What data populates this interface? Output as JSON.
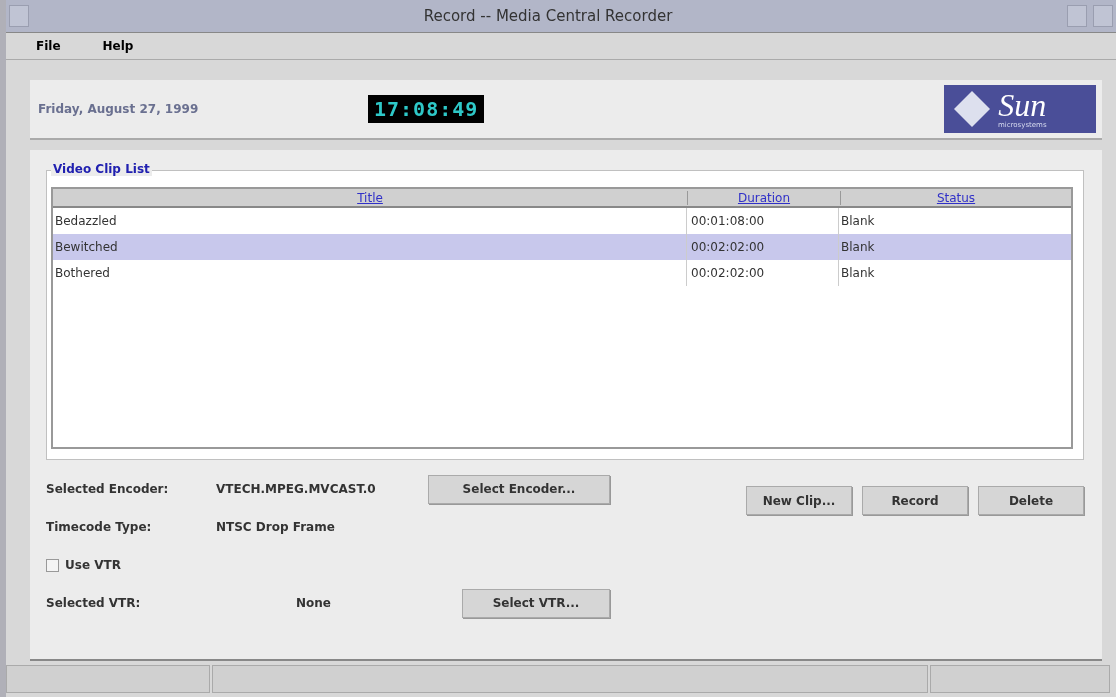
{
  "window": {
    "title": "Record -- Media Central Recorder"
  },
  "menu": [
    "File",
    "Help"
  ],
  "header": {
    "date": "Friday, August 27, 1999",
    "clock": "17:08:49",
    "logo": {
      "name": "Sun",
      "tagline": "microsystems"
    }
  },
  "clip_list": {
    "title": "Video Clip List",
    "columns": [
      "Title",
      "Duration",
      "Status"
    ],
    "rows": [
      {
        "cells": [
          "Bedazzled",
          "00:01:08:00",
          "Blank"
        ],
        "selected": false
      },
      {
        "cells": [
          "Bewitched",
          "00:02:02:00",
          "Blank"
        ],
        "selected": true
      },
      {
        "cells": [
          "Bothered",
          "00:02:02:00",
          "Blank"
        ],
        "selected": false
      }
    ]
  },
  "encoder": {
    "label": "Selected Encoder:",
    "value": "VTECH.MPEG.MVCAST.0",
    "button": "Select Encoder..."
  },
  "timecode": {
    "label": "Timecode Type:",
    "value": "NTSC Drop Frame"
  },
  "use_vtr": {
    "label": "Use VTR",
    "checked": false
  },
  "vtr": {
    "label": "Selected VTR:",
    "value": "None",
    "button": "Select VTR..."
  },
  "actions": [
    "New Clip...",
    "Record",
    "Delete"
  ]
}
